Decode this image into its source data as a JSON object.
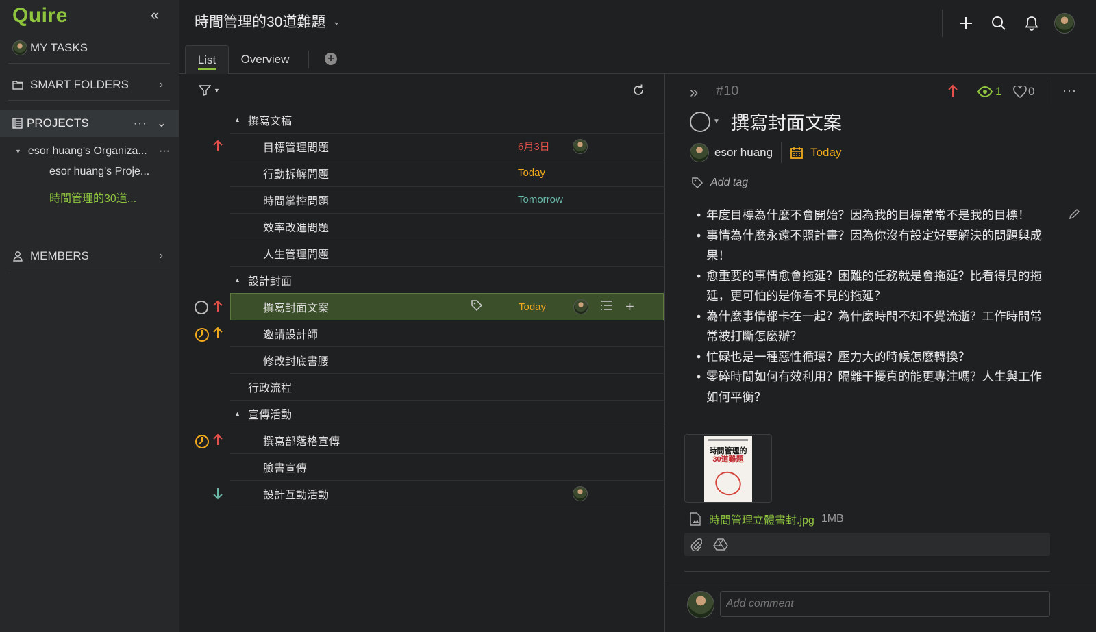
{
  "app": {
    "logo": "Quire",
    "accent": "#8fc53e"
  },
  "sidebar": {
    "my_tasks": "MY TASKS",
    "smart_folders": "SMART FOLDERS",
    "projects": "PROJECTS",
    "projects_more": "···",
    "organization": "esor huang's Organiza...",
    "org_more": "···",
    "project_items": [
      "esor huang's Proje...",
      "時間管理的30道..."
    ],
    "members": "MEMBERS"
  },
  "header": {
    "project_title": "時間管理的30道難題",
    "tabs": [
      {
        "label": "List"
      },
      {
        "label": "Overview"
      }
    ]
  },
  "task_list": {
    "rows": [
      {
        "name": "撰寫文稿",
        "type": "section"
      },
      {
        "name": "目標管理問題",
        "date": "6月3日",
        "date_color": "red",
        "priority": "high",
        "assignee": true
      },
      {
        "name": "行動拆解問題",
        "date": "Today",
        "date_color": "orange"
      },
      {
        "name": "時間掌控問題",
        "date": "Tomorrow",
        "date_color": "teal"
      },
      {
        "name": "效率改進問題"
      },
      {
        "name": "人生管理問題"
      },
      {
        "name": "設計封面",
        "type": "section"
      },
      {
        "name": "撰寫封面文案",
        "date": "Today",
        "date_color": "orange",
        "priority": "high",
        "assignee": true,
        "selected": true,
        "status": "none"
      },
      {
        "name": "邀請設計師",
        "priority": "high-orange",
        "status": "in-progress"
      },
      {
        "name": "修改封底書腰"
      },
      {
        "name": "行政流程",
        "type": "top"
      },
      {
        "name": "宣傳活動",
        "type": "section"
      },
      {
        "name": "撰寫部落格宣傳",
        "priority": "high",
        "status": "in-progress"
      },
      {
        "name": "臉書宣傳"
      },
      {
        "name": "設計互動活動",
        "priority": "low",
        "assignee": true
      }
    ]
  },
  "detail": {
    "task_id": "#10",
    "watchers": "1",
    "likes": "0",
    "title": "撰寫封面文案",
    "assignee": "esor huang",
    "due": "Today",
    "add_tag": "Add tag",
    "description": [
      "年度目標為什麼不會開始？因為我的目標常常不是我的目標！",
      "事情為什麼永遠不照計畫？因為你沒有設定好要解決的問題與成果！",
      "愈重要的事情愈會拖延？困難的任務就是會拖延？比看得見的拖延，更可怕的是你看不見的拖延？",
      "為什麼事情都卡在一起？為什麼時間不知不覺流逝？工作時間常常被打斷怎麼辦？",
      "忙碌也是一種惡性循環？壓力大的時候怎麼轉換？",
      "零碎時間如何有效利用？隔離干擾真的能更專注嗎？人生與工作如何平衡？"
    ],
    "cover_title_1": "時間管理的",
    "cover_title_2": "30道難題",
    "attachment_name": "時間管理立體書封.jpg",
    "attachment_size": "1MB",
    "comment_placeholder": "Add comment"
  }
}
